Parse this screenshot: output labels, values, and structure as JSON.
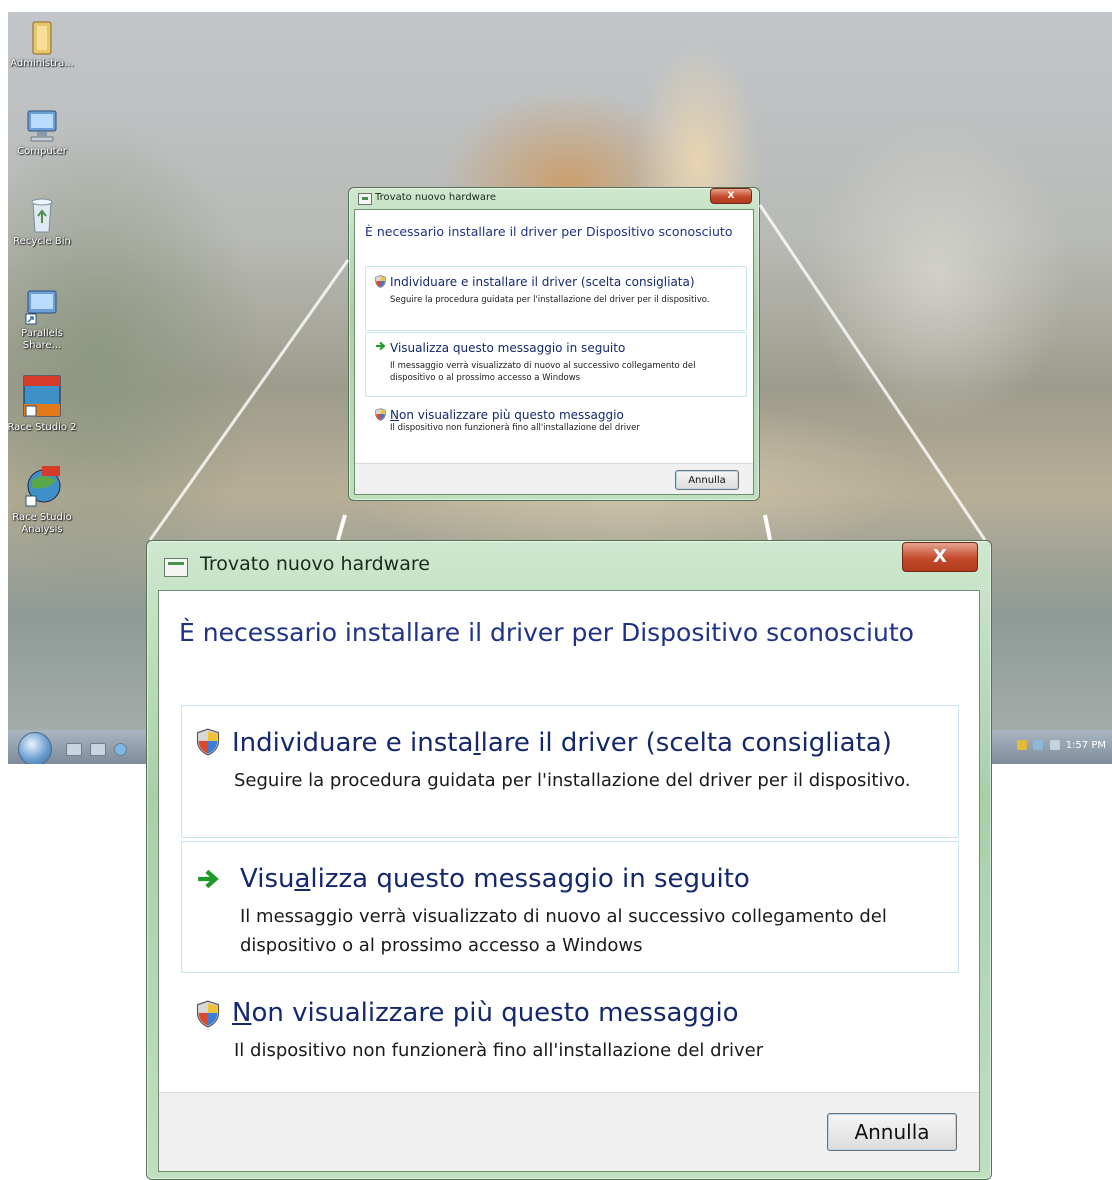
{
  "desktop": {
    "icons": [
      {
        "label": "Administra...",
        "icon": "user-folder-icon"
      },
      {
        "label": "Computer",
        "icon": "computer-icon"
      },
      {
        "label": "Recycle Bin",
        "icon": "recycle-bin-icon"
      },
      {
        "label": "Parallels Share...",
        "icon": "network-share-icon"
      },
      {
        "label": "Race Studio 2",
        "icon": "race-studio-icon"
      },
      {
        "label": "Race Studio Analysis",
        "icon": "race-studio-analysis-icon"
      }
    ],
    "taskbar": {
      "clock": "1:57 PM"
    }
  },
  "dialog": {
    "title": "Trovato nuovo hardware",
    "close_label": "X",
    "heading": "È necessario installare il driver per Dispositivo sconosciuto",
    "options": [
      {
        "icon": "uac-shield-icon",
        "title_pre": "Individuare e insta",
        "title_key": "l",
        "title_post": "lare il driver (scelta consigliata)",
        "description": "Seguire la procedura guidata per l'installazione del driver per il dispositivo."
      },
      {
        "icon": "green-arrow-icon",
        "title_pre": "Visu",
        "title_key": "a",
        "title_post": "lizza questo messaggio in seguito",
        "description": "Il messaggio verrà visualizzato di nuovo al successivo collegamento del dispositivo o al prossimo accesso a Windows"
      },
      {
        "icon": "uac-shield-icon",
        "title_pre": "",
        "title_key": "N",
        "title_post": "on visualizzare più questo messaggio",
        "description": "Il dispositivo non funzionerà fino all'installazione del driver"
      }
    ],
    "cancel_label": "Annulla"
  },
  "colors": {
    "heading": "#1e3287",
    "frame": "#a9cfa9",
    "close_button": "#c34a2c"
  }
}
